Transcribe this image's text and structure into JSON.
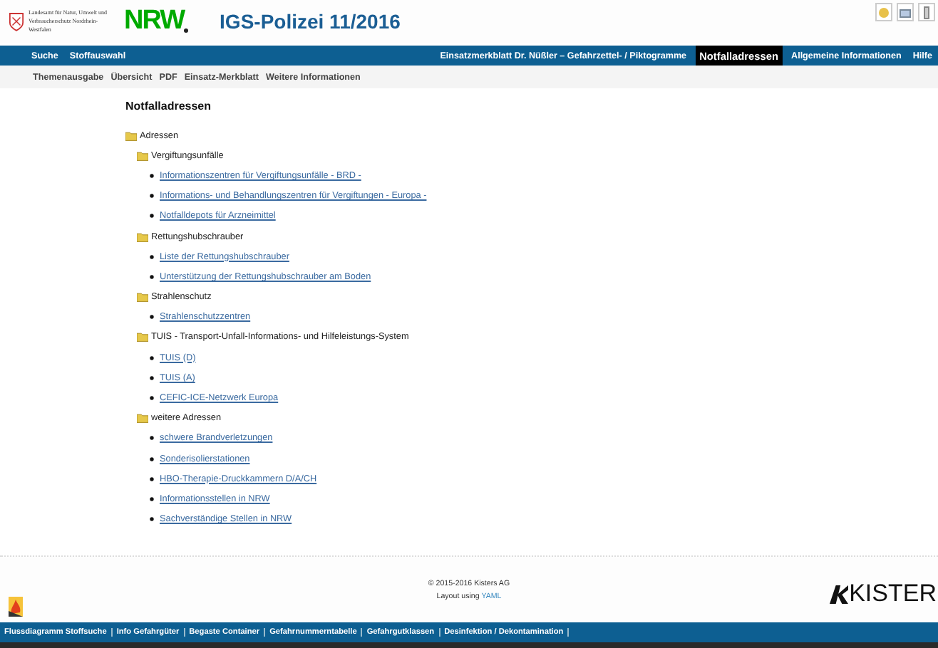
{
  "header": {
    "agency": "Landesamt für Natur, Umwelt und Verbraucherschutz Nordrhein-Westfalen",
    "logo": "NRW",
    "title": "IGS-Polizei 11/2016"
  },
  "main_nav": {
    "left": [
      {
        "label": "Suche",
        "selected": false
      },
      {
        "label": "Stoffauswahl",
        "selected": false
      }
    ],
    "right": [
      {
        "label": "Einsatzmerkblatt Dr. Nüßler – Gefahrzettel- / Piktogramme",
        "selected": false
      },
      {
        "label": "Notfalladressen",
        "selected": true
      },
      {
        "label": "Allgemeine Informationen",
        "selected": false
      },
      {
        "label": "Hilfe",
        "selected": false
      }
    ]
  },
  "sub_nav": [
    "Themenausgabe",
    "Übersicht",
    "PDF",
    "Einsatz-Merkblatt",
    "Weitere Informationen"
  ],
  "heading": "Notfalladressen",
  "tree": {
    "label": "Adressen",
    "kind": "folder",
    "children": [
      {
        "label": "Vergiftungsunfälle",
        "kind": "folder",
        "children": [
          {
            "label": "Informationszentren für Vergiftungsunfälle - BRD -",
            "kind": "link"
          },
          {
            "label": "Informations- und Behandlungszentren für Vergiftungen - Europa -",
            "kind": "link"
          },
          {
            "label": "Notfalldepots für Arzneimittel",
            "kind": "link"
          }
        ]
      },
      {
        "label": "Rettungshubschrauber",
        "kind": "folder",
        "children": [
          {
            "label": "Liste der Rettungshubschrauber",
            "kind": "link"
          },
          {
            "label": "Unterstützung der Rettungshubschrauber am Boden",
            "kind": "link"
          }
        ]
      },
      {
        "label": "Strahlenschutz",
        "kind": "folder",
        "children": [
          {
            "label": "Strahlenschutzzentren",
            "kind": "link"
          }
        ]
      },
      {
        "label": "TUIS - Transport-Unfall-Informations- und Hilfeleistungs-System",
        "kind": "folder",
        "children": [
          {
            "label": "TUIS (D)",
            "kind": "link"
          },
          {
            "label": "TUIS (A)",
            "kind": "link"
          },
          {
            "label": "CEFIC-ICE-Netzwerk Europa",
            "kind": "link"
          }
        ]
      },
      {
        "label": "weitere Adressen",
        "kind": "folder",
        "children": [
          {
            "label": "schwere Brandverletzungen",
            "kind": "link"
          },
          {
            "label": "Sonderisolierstationen",
            "kind": "link"
          },
          {
            "label": "HBO-Therapie-Druckkammern D/A/CH",
            "kind": "link"
          },
          {
            "label": "Informationsstellen in NRW",
            "kind": "link"
          },
          {
            "label": "Sachverständige Stellen in NRW",
            "kind": "link"
          }
        ]
      }
    ]
  },
  "footer": {
    "copyright": "© 2015-2016 Kisters AG",
    "layout_text": "Layout using",
    "layout_link": "YAML",
    "company": "KISTER"
  },
  "bottom_nav": [
    "Flussdiagramm Stoffsuche",
    "Info Gefahrgüter",
    "Begaste Container",
    "Gefahrnummerntabelle",
    "Gefahrgutklassen",
    "Desinfektion / Dekontamination"
  ]
}
